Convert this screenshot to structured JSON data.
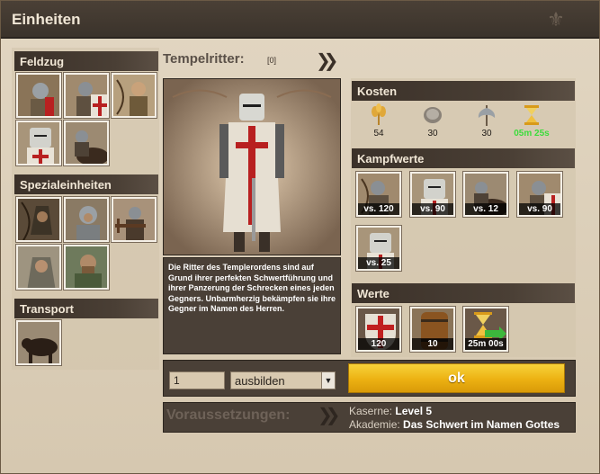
{
  "window": {
    "title": "Einheiten"
  },
  "sections": {
    "feldzug": {
      "label": "Feldzug"
    },
    "spezial": {
      "label": "Spezialeinheiten"
    },
    "transport": {
      "label": "Transport"
    }
  },
  "unit": {
    "name": "Tempelritter:",
    "count": "[0]",
    "description": "Die Ritter des Templerordens sind auf Grund ihrer perfekten Schwertführung und ihrer Panzerung der Schrecken eines jeden Gegners. Unbarmherzig bekämpfen sie ihre Gegner im Namen des Herren."
  },
  "kosten": {
    "label": "Kosten",
    "items": [
      {
        "icon": "wheat-icon",
        "value": "54"
      },
      {
        "icon": "coins-icon",
        "value": "30"
      },
      {
        "icon": "axe-icon",
        "value": "30"
      },
      {
        "icon": "hourglass-icon",
        "value": "05m 25s"
      }
    ]
  },
  "kampfwerte": {
    "label": "Kampfwerte",
    "items": [
      {
        "value": "vs. 120"
      },
      {
        "value": "vs. 90"
      },
      {
        "value": "vs. 12"
      },
      {
        "value": "vs. 90"
      },
      {
        "value": "vs. 25"
      }
    ]
  },
  "werte": {
    "label": "Werte",
    "items": [
      {
        "icon": "shield-icon",
        "value": "120"
      },
      {
        "icon": "barrel-icon",
        "value": "10"
      },
      {
        "icon": "speed-hourglass-icon",
        "value": "25m 00s"
      }
    ]
  },
  "train": {
    "quantity": "1",
    "action": "ausbilden",
    "ok_label": "ok"
  },
  "requirements": {
    "label": "Voraussetzungen:",
    "items": [
      {
        "key": "Kaserne:",
        "value": "Level 5"
      },
      {
        "key": "Akademie:",
        "value": "Das Schwert im Namen Gottes"
      }
    ]
  },
  "colors": {
    "header_dark": "#3b3129",
    "accent_yellow": "#ecb112",
    "time_green": "#3cdc3c"
  }
}
